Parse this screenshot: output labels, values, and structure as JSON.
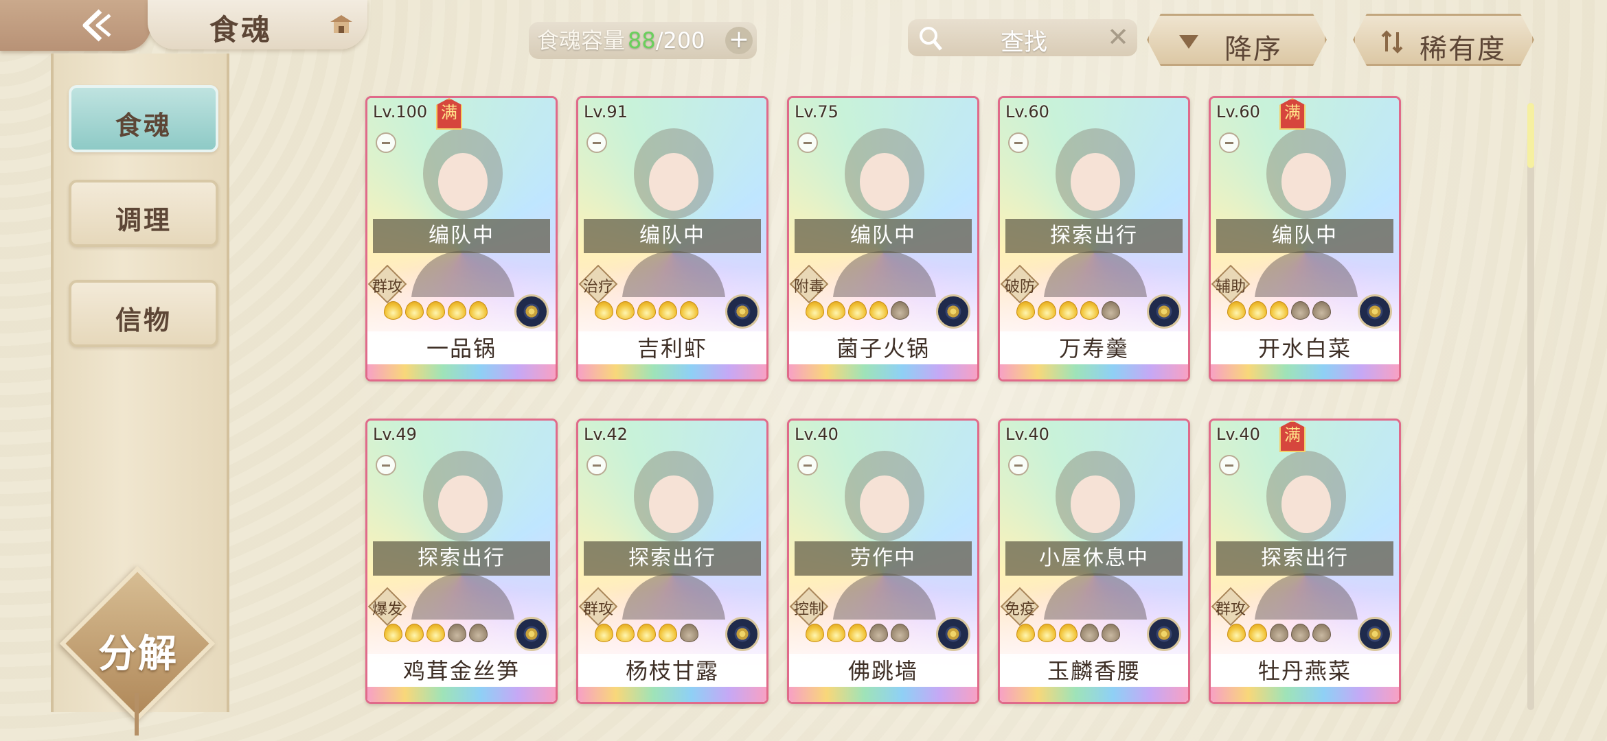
{
  "header": {
    "title": "食魂",
    "capacity": {
      "label": "食魂容量",
      "current": "88",
      "total": "/200"
    },
    "search": {
      "label": "查找"
    },
    "sort_order": {
      "label": "降序"
    },
    "sort_key": {
      "label": "稀有度"
    }
  },
  "sidebar": {
    "items": [
      {
        "label": "食魂",
        "active": true
      },
      {
        "label": "调理",
        "active": false
      },
      {
        "label": "信物",
        "active": false
      }
    ],
    "decompose_label": "分解"
  },
  "cards": [
    {
      "level": "Lv.100",
      "max": "满",
      "status": "编队中",
      "role": "群攻",
      "name": "一品锅",
      "stars": 5,
      "total": 5
    },
    {
      "level": "Lv.91",
      "max": "",
      "status": "编队中",
      "role": "治疗",
      "name": "吉利虾",
      "stars": 5,
      "total": 5
    },
    {
      "level": "Lv.75",
      "max": "",
      "status": "编队中",
      "role": "附毒",
      "name": "菌子火锅",
      "stars": 4,
      "total": 5
    },
    {
      "level": "Lv.60",
      "max": "",
      "status": "探索出行",
      "role": "破防",
      "name": "万寿羹",
      "stars": 4,
      "total": 5
    },
    {
      "level": "Lv.60",
      "max": "满",
      "status": "编队中",
      "role": "辅助",
      "name": "开水白菜",
      "stars": 3,
      "total": 5
    },
    {
      "level": "Lv.49",
      "max": "",
      "status": "探索出行",
      "role": "爆发",
      "name": "鸡茸金丝笋",
      "stars": 3,
      "total": 5
    },
    {
      "level": "Lv.42",
      "max": "",
      "status": "探索出行",
      "role": "群攻",
      "name": "杨枝甘露",
      "stars": 4,
      "total": 5
    },
    {
      "level": "Lv.40",
      "max": "",
      "status": "劳作中",
      "role": "控制",
      "name": "佛跳墙",
      "stars": 3,
      "total": 5
    },
    {
      "level": "Lv.40",
      "max": "",
      "status": "小屋休息中",
      "role": "免疫",
      "name": "玉麟香腰",
      "stars": 3,
      "total": 5
    },
    {
      "level": "Lv.40",
      "max": "满",
      "status": "探索出行",
      "role": "群攻",
      "name": "牡丹燕菜",
      "stars": 2,
      "total": 5
    }
  ],
  "colors": {
    "accent_green": "#6ad05c",
    "active_tab": "#8ecac6",
    "card_border": "#e06a8a",
    "text_brown": "#5d4636"
  }
}
